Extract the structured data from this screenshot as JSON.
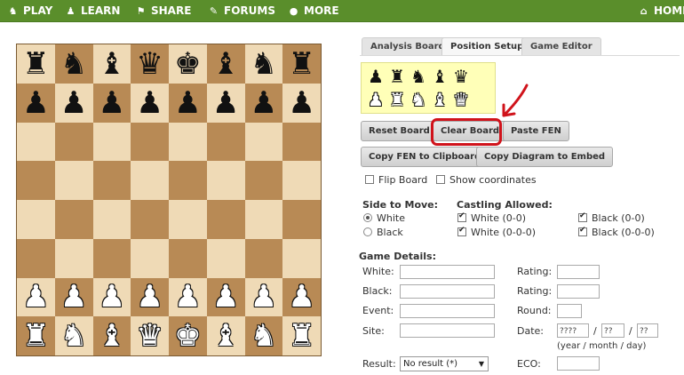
{
  "nav": {
    "items": [
      {
        "label": "PLAY",
        "icon": "♞"
      },
      {
        "label": "LEARN",
        "icon": "♟"
      },
      {
        "label": "SHARE",
        "icon": "⚑"
      },
      {
        "label": "FORUMS",
        "icon": "✎"
      },
      {
        "label": "MORE",
        "icon": "●"
      }
    ],
    "home": {
      "label": "HOME",
      "icon": "⌂"
    }
  },
  "board": {
    "light_color": "#efdab6",
    "dark_color": "#b88a55",
    "ranks": [
      [
        "br",
        "bn",
        "bb",
        "bq",
        "bk",
        "bb",
        "bn",
        "br"
      ],
      [
        "bp",
        "bp",
        "bp",
        "bp",
        "bp",
        "bp",
        "bp",
        "bp"
      ],
      [
        "",
        "",
        "",
        "",
        "",
        "",
        "",
        ""
      ],
      [
        "",
        "",
        "",
        "",
        "",
        "",
        "",
        ""
      ],
      [
        "",
        "",
        "",
        "",
        "",
        "",
        "",
        ""
      ],
      [
        "",
        "",
        "",
        "",
        "",
        "",
        "",
        ""
      ],
      [
        "wp",
        "wp",
        "wp",
        "wp",
        "wp",
        "wp",
        "wp",
        "wp"
      ],
      [
        "wr",
        "wn",
        "wb",
        "wq",
        "wk",
        "wb",
        "wn",
        "wr"
      ]
    ]
  },
  "tabs": {
    "analysis": "Analysis Board",
    "position": "Position Setup",
    "editor": "Game Editor"
  },
  "palette": {
    "black": [
      "bp",
      "br",
      "bn",
      "bb",
      "bq"
    ],
    "white": [
      "wp",
      "wr",
      "wn",
      "wb",
      "wq"
    ]
  },
  "buttons": {
    "reset": "Reset Board",
    "clear": "Clear Board",
    "paste": "Paste FEN",
    "copy_fen": "Copy FEN to Clipboard",
    "copy_diagram": "Copy Diagram to Embed"
  },
  "options": {
    "flip": "Flip Board",
    "coords": "Show coordinates"
  },
  "side": {
    "heading": "Side to Move:",
    "white": "White",
    "black": "Black"
  },
  "castling": {
    "heading": "Castling Allowed:",
    "w_short": "White (0-0)",
    "w_long": "White (0-0-0)",
    "b_short": "Black (0-0)",
    "b_long": "Black (0-0-0)"
  },
  "details": {
    "heading": "Game Details:",
    "white": "White:",
    "black": "Black:",
    "event": "Event:",
    "site": "Site:",
    "result": "Result:",
    "rating1": "Rating:",
    "rating2": "Rating:",
    "round": "Round:",
    "date": "Date:",
    "eco": "ECO:",
    "date_year": "????",
    "date_month": "??",
    "date_day": "??",
    "date_sep": "/",
    "date_hint": "(year / month / day)",
    "result_value": "No result (*)"
  }
}
